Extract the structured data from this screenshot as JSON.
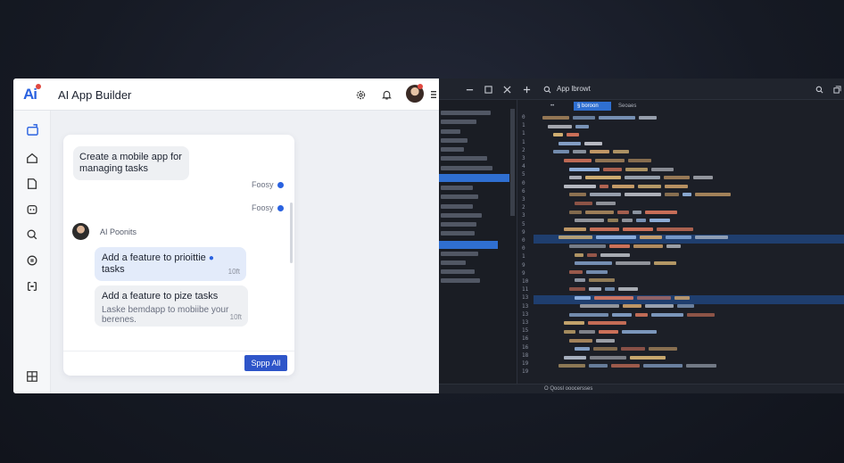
{
  "app": {
    "logo": "Ai",
    "title": "AI App Builder"
  },
  "chat": {
    "user_message": "Create a mobile app for managing tasks",
    "meta1": "Foosy",
    "meta2": "Foosy",
    "assistant_name": "AI Poonits",
    "suggestion1": "Add a feature to prioittie",
    "suggestion1_line2": "tasks",
    "suggestion1_time": "10ft",
    "suggestion2": "Add a feature to pize tasks",
    "suggestion2_sub": "Laske bemdapp to mobiibe your berenes.",
    "suggestion2_time": "10ft",
    "apply_label": "Sppp All"
  },
  "editor": {
    "title": "App lbrowt",
    "tab_active": "§ boroon",
    "tab2": "Seoaes",
    "status": "O Qoosl ooocersses",
    "line_numbers": [
      "0",
      "1",
      "1",
      "1",
      "2",
      "3",
      "4",
      "5",
      "0",
      "6",
      "3",
      "2",
      "3",
      "5",
      "9",
      "0",
      "0",
      "1",
      "9",
      "9",
      "10",
      "11",
      "13",
      "13",
      "13",
      "13",
      "15",
      "16",
      "16",
      "18",
      "19",
      "19"
    ]
  },
  "colors": {
    "accent": "#2a62e0",
    "button": "#2e55c9",
    "editor_bg": "#1c1f27",
    "highlight": "#204a87"
  },
  "icons": {
    "topbar": [
      "settings-icon",
      "notification-icon",
      "more-icon"
    ],
    "rail": [
      "folder-icon",
      "home-icon",
      "page-icon",
      "bot-icon",
      "search-icon",
      "compass-icon",
      "layout-icon",
      "grid-icon"
    ],
    "editor_topbar": [
      "minimize-icon",
      "maximize-icon",
      "close-icon",
      "plus-icon",
      "search-icon",
      "search-icon",
      "copy-icon"
    ]
  }
}
